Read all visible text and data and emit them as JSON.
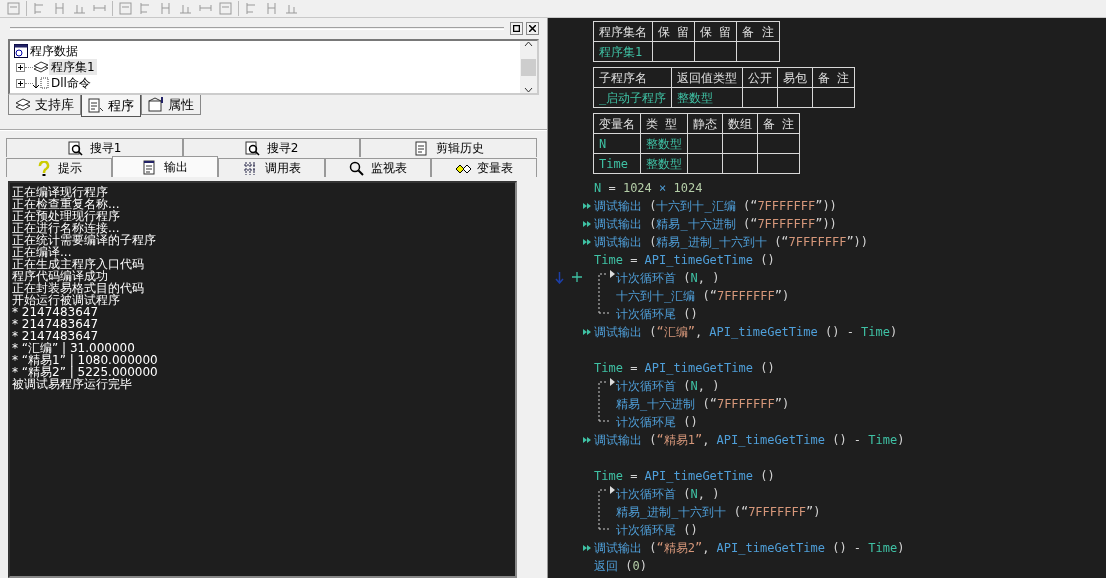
{
  "panel": {
    "tree": [
      {
        "label": "程序数据",
        "children": [
          {
            "label": "程序集1",
            "selected": true,
            "expanded": false
          },
          {
            "label": "Dll命令",
            "selected": false,
            "expanded": false
          }
        ]
      }
    ],
    "tabs": [
      {
        "label": "支持库",
        "selected": false
      },
      {
        "label": "程序",
        "selected": true
      },
      {
        "label": "属性",
        "selected": false
      }
    ]
  },
  "bottom_tabs": {
    "row_1": [
      {
        "label": "搜寻1",
        "selected": false
      },
      {
        "label": "搜寻2",
        "selected": false
      },
      {
        "label": "剪辑历史",
        "selected": false
      }
    ],
    "row_2": [
      {
        "label": "提示",
        "selected": false
      },
      {
        "label": "输出",
        "selected": true
      },
      {
        "label": "调用表",
        "selected": false
      },
      {
        "label": "监视表",
        "selected": false
      },
      {
        "label": "变量表",
        "selected": false
      }
    ]
  },
  "output": [
    "正在编译现行程序",
    "正在检查重复名称...",
    "正在预处理现行程序",
    "正在进行名称连接...",
    "正在统计需要编译的子程序",
    "正在编译...",
    "正在生成主程序入口代码",
    "程序代码编译成功",
    "正在封装易格式目的代码",
    "开始运行被调试程序",
    "* 2147483647",
    "* 2147483647",
    "* 2147483647",
    "* “汇编” | 31.000000",
    "* “精易1” | 1080.000000",
    "* “精易2” | 5225.000000",
    "被调试易程序运行完毕"
  ],
  "tables": [
    {
      "columns": [
        "程序集名",
        "保 留",
        "保 留",
        "备 注"
      ],
      "rows": [
        [
          "程序集1",
          null,
          null,
          null
        ]
      ]
    },
    {
      "columns": [
        "子程序名",
        "返回值类型",
        "公开",
        "易包",
        "备 注"
      ],
      "rows": [
        [
          "_启动子程序",
          "整数型",
          null,
          null,
          null
        ]
      ]
    },
    {
      "columns": [
        "变量名",
        "类 型",
        "静态",
        "数组",
        "备 注"
      ],
      "rows": [
        [
          "N",
          "整数型",
          null,
          null,
          null
        ],
        [
          "Time",
          "整数型",
          null,
          null,
          null
        ]
      ]
    }
  ],
  "code": [
    {
      "kind": "stmt",
      "tokens": [
        {
          "text": "N",
          "kind": "var"
        },
        {
          "text": " = ",
          "kind": "op"
        },
        {
          "text": "1024",
          "kind": "num"
        },
        {
          "text": " × ",
          "kind": "func"
        },
        {
          "text": "1024",
          "kind": "num"
        }
      ]
    },
    {
      "kind": "debug",
      "tokens": [
        {
          "text": "调试输出",
          "kind": "func"
        },
        {
          "text": " (",
          "kind": "op"
        },
        {
          "text": "十六到十_汇编",
          "kind": "func"
        },
        {
          "text": " (“",
          "kind": "op"
        },
        {
          "text": "7FFFFFFF",
          "kind": "str"
        },
        {
          "text": "”))",
          "kind": "op"
        }
      ]
    },
    {
      "kind": "debug",
      "tokens": [
        {
          "text": "调试输出",
          "kind": "func"
        },
        {
          "text": " (",
          "kind": "op"
        },
        {
          "text": "精易_十六进制",
          "kind": "func"
        },
        {
          "text": " (“",
          "kind": "op"
        },
        {
          "text": "7FFFFFFF",
          "kind": "str"
        },
        {
          "text": "”))",
          "kind": "op"
        }
      ]
    },
    {
      "kind": "debug",
      "tokens": [
        {
          "text": "调试输出",
          "kind": "func"
        },
        {
          "text": " (",
          "kind": "op"
        },
        {
          "text": "精易_进制_十六到十",
          "kind": "func"
        },
        {
          "text": " (“",
          "kind": "op"
        },
        {
          "text": "7FFFFFFF",
          "kind": "str"
        },
        {
          "text": "”))",
          "kind": "op"
        }
      ]
    },
    {
      "kind": "stmt",
      "tokens": [
        {
          "text": "Time",
          "kind": "var"
        },
        {
          "text": " = ",
          "kind": "op"
        },
        {
          "text": "API_timeGetTime",
          "kind": "func"
        },
        {
          "text": " ()",
          "kind": "op"
        }
      ]
    },
    {
      "kind": "loop",
      "marked": true,
      "start": [
        {
          "text": "计次循环首",
          "kind": "func"
        },
        {
          "text": " (",
          "kind": "op"
        },
        {
          "text": "N",
          "kind": "var"
        },
        {
          "text": ", )",
          "kind": "op"
        }
      ],
      "body": [
        {
          "text": "十六到十_汇编",
          "kind": "func"
        },
        {
          "text": " (“",
          "kind": "op"
        },
        {
          "text": "7FFFFFFF",
          "kind": "str"
        },
        {
          "text": "”)",
          "kind": "op"
        }
      ],
      "end": [
        {
          "text": "计次循环尾",
          "kind": "func"
        },
        {
          "text": " ()",
          "kind": "op"
        }
      ]
    },
    {
      "kind": "debug",
      "tokens": [
        {
          "text": "调试输出",
          "kind": "func"
        },
        {
          "text": " (",
          "kind": "op"
        },
        {
          "text": "“汇编”",
          "kind": "str"
        },
        {
          "text": ", ",
          "kind": "op"
        },
        {
          "text": "API_timeGetTime",
          "kind": "func"
        },
        {
          "text": " () - ",
          "kind": "op"
        },
        {
          "text": "Time",
          "kind": "var"
        },
        {
          "text": ")",
          "kind": "op"
        }
      ]
    },
    {
      "kind": "blank"
    },
    {
      "kind": "stmt",
      "tokens": [
        {
          "text": "Time",
          "kind": "var"
        },
        {
          "text": " = ",
          "kind": "op"
        },
        {
          "text": "API_timeGetTime",
          "kind": "func"
        },
        {
          "text": " ()",
          "kind": "op"
        }
      ]
    },
    {
      "kind": "loop",
      "marked": false,
      "start": [
        {
          "text": "计次循环首",
          "kind": "func"
        },
        {
          "text": " (",
          "kind": "op"
        },
        {
          "text": "N",
          "kind": "var"
        },
        {
          "text": ", )",
          "kind": "op"
        }
      ],
      "body": [
        {
          "text": "精易_十六进制",
          "kind": "func"
        },
        {
          "text": " (“",
          "kind": "op"
        },
        {
          "text": "7FFFFFFF",
          "kind": "str"
        },
        {
          "text": "”)",
          "kind": "op"
        }
      ],
      "end": [
        {
          "text": "计次循环尾",
          "kind": "func"
        },
        {
          "text": " ()",
          "kind": "op"
        }
      ]
    },
    {
      "kind": "debug",
      "tokens": [
        {
          "text": "调试输出",
          "kind": "func"
        },
        {
          "text": " (",
          "kind": "op"
        },
        {
          "text": "“精易1”",
          "kind": "str"
        },
        {
          "text": ", ",
          "kind": "op"
        },
        {
          "text": "API_timeGetTime",
          "kind": "func"
        },
        {
          "text": " () - ",
          "kind": "op"
        },
        {
          "text": "Time",
          "kind": "var"
        },
        {
          "text": ")",
          "kind": "op"
        }
      ]
    },
    {
      "kind": "blank"
    },
    {
      "kind": "stmt",
      "tokens": [
        {
          "text": "Time",
          "kind": "var"
        },
        {
          "text": " = ",
          "kind": "op"
        },
        {
          "text": "API_timeGetTime",
          "kind": "func"
        },
        {
          "text": " ()",
          "kind": "op"
        }
      ]
    },
    {
      "kind": "loop",
      "marked": false,
      "start": [
        {
          "text": "计次循环首",
          "kind": "func"
        },
        {
          "text": " (",
          "kind": "op"
        },
        {
          "text": "N",
          "kind": "var"
        },
        {
          "text": ", )",
          "kind": "op"
        }
      ],
      "body": [
        {
          "text": "精易_进制_十六到十",
          "kind": "func"
        },
        {
          "text": " (“",
          "kind": "op"
        },
        {
          "text": "7FFFFFFF",
          "kind": "str"
        },
        {
          "text": "”)",
          "kind": "op"
        }
      ],
      "end": [
        {
          "text": "计次循环尾",
          "kind": "func"
        },
        {
          "text": " ()",
          "kind": "op"
        }
      ]
    },
    {
      "kind": "debug",
      "tokens": [
        {
          "text": "调试输出",
          "kind": "func"
        },
        {
          "text": " (",
          "kind": "op"
        },
        {
          "text": "“精易2”",
          "kind": "str"
        },
        {
          "text": ", ",
          "kind": "op"
        },
        {
          "text": "API_timeGetTime",
          "kind": "func"
        },
        {
          "text": " () - ",
          "kind": "op"
        },
        {
          "text": "Time",
          "kind": "var"
        },
        {
          "text": ")",
          "kind": "op"
        }
      ]
    },
    {
      "kind": "stmt",
      "tokens": [
        {
          "text": "返回",
          "kind": "func"
        },
        {
          "text": " (",
          "kind": "op"
        },
        {
          "text": "0",
          "kind": "num"
        },
        {
          "text": ")",
          "kind": "op"
        }
      ]
    }
  ]
}
